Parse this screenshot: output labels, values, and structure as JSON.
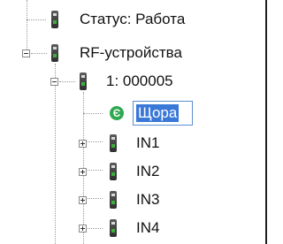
{
  "tree": {
    "items": [
      {
        "label": "Статус: Работа"
      },
      {
        "label": "RF-устройства"
      },
      {
        "label": "1: 000005"
      },
      {
        "label": "Щора",
        "icon_letter": "Є"
      },
      {
        "label": "IN1"
      },
      {
        "label": "IN2"
      },
      {
        "label": "IN3"
      },
      {
        "label": "IN4"
      }
    ]
  },
  "colors": {
    "selection": "#3a78d8",
    "edit_border": "#5a8fd0",
    "e_icon": "#2fa84f"
  }
}
